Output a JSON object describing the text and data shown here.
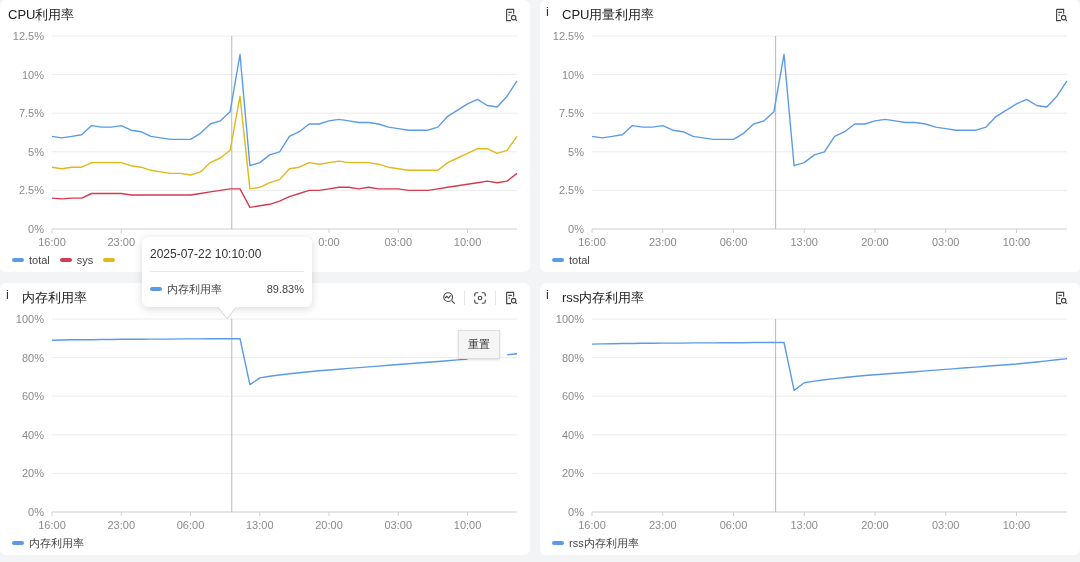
{
  "panels": [
    {
      "title": "CPU利用率",
      "tools": [
        {
          "kind": "detail"
        }
      ],
      "chart_data": {
        "type": "line",
        "ylim": [
          0,
          12.5
        ],
        "yticks": [
          {
            "value": 0,
            "label": "0%"
          },
          {
            "value": 2.5,
            "label": "2.5%"
          },
          {
            "value": 5,
            "label": "5%"
          },
          {
            "value": 7.5,
            "label": "7.5%"
          },
          {
            "value": 10,
            "label": "10%"
          },
          {
            "value": 12.5,
            "label": "12.5%"
          }
        ],
        "categories": [
          "16:00",
          null,
          null,
          null,
          null,
          null,
          null,
          "23:00",
          null,
          null,
          null,
          null,
          null,
          null,
          null,
          null,
          null,
          null,
          null,
          null,
          null,
          null,
          null,
          null,
          null,
          null,
          null,
          null,
          "0:00",
          null,
          null,
          null,
          null,
          null,
          null,
          "03:00",
          null,
          null,
          null,
          null,
          null,
          null,
          "10:00",
          null,
          null,
          null,
          null,
          null
        ],
        "series": [
          {
            "name": "total",
            "color": "#5b9be6",
            "values": [
              6.0,
              5.9,
              6.0,
              6.1,
              6.7,
              6.6,
              6.6,
              6.7,
              6.4,
              6.3,
              6.0,
              5.9,
              5.8,
              5.8,
              5.8,
              6.2,
              6.8,
              7.0,
              7.6,
              11.3,
              4.1,
              4.3,
              4.8,
              5.0,
              6.0,
              6.3,
              6.8,
              6.8,
              7.0,
              7.1,
              7.0,
              6.9,
              6.9,
              6.8,
              6.6,
              6.5,
              6.4,
              6.4,
              6.4,
              6.6,
              7.3,
              7.7,
              8.1,
              8.4,
              8.0,
              7.9,
              8.6,
              9.6
            ]
          },
          {
            "name": "sys",
            "color": "#d63a4f",
            "values": [
              2.0,
              1.95,
              2.0,
              2.0,
              2.3,
              2.3,
              2.3,
              2.3,
              2.2,
              2.2,
              2.2,
              2.2,
              2.2,
              2.2,
              2.2,
              2.3,
              2.4,
              2.5,
              2.6,
              2.6,
              1.4,
              1.5,
              1.6,
              1.8,
              2.1,
              2.3,
              2.5,
              2.5,
              2.6,
              2.7,
              2.7,
              2.6,
              2.7,
              2.6,
              2.6,
              2.6,
              2.5,
              2.5,
              2.5,
              2.6,
              2.7,
              2.8,
              2.9,
              3.0,
              3.1,
              3.0,
              3.1,
              3.6
            ]
          },
          {
            "color": "#e0b81c",
            "values": [
              4.0,
              3.9,
              4.0,
              4.0,
              4.3,
              4.3,
              4.3,
              4.3,
              4.1,
              4.0,
              3.8,
              3.7,
              3.6,
              3.6,
              3.5,
              3.7,
              4.3,
              4.6,
              5.1,
              8.6,
              2.6,
              2.7,
              3.0,
              3.2,
              3.9,
              4.0,
              4.3,
              4.2,
              4.3,
              4.4,
              4.3,
              4.3,
              4.3,
              4.2,
              4.0,
              3.9,
              3.8,
              3.8,
              3.8,
              3.8,
              4.3,
              4.6,
              4.9,
              5.2,
              5.2,
              4.9,
              5.1,
              6.0
            ]
          }
        ],
        "grid": true
      }
    },
    {
      "info_mark": "i",
      "title": "CPU用量利用率",
      "tools": [
        {
          "kind": "detail"
        }
      ],
      "chart_data": {
        "type": "line",
        "ylim": [
          0,
          12.5
        ],
        "yticks": [
          {
            "value": 0,
            "label": "0%"
          },
          {
            "value": 2.5,
            "label": "2.5%"
          },
          {
            "value": 5,
            "label": "5%"
          },
          {
            "value": 7.5,
            "label": "7.5%"
          },
          {
            "value": 10,
            "label": "10%"
          },
          {
            "value": 12.5,
            "label": "12.5%"
          }
        ],
        "categories": [
          "16:00",
          null,
          null,
          null,
          null,
          null,
          null,
          "23:00",
          null,
          null,
          null,
          null,
          null,
          null,
          "06:00",
          null,
          null,
          null,
          null,
          null,
          null,
          "13:00",
          null,
          null,
          null,
          null,
          null,
          null,
          "20:00",
          null,
          null,
          null,
          null,
          null,
          null,
          "03:00",
          null,
          null,
          null,
          null,
          null,
          null,
          "10:00",
          null,
          null,
          null,
          null,
          null
        ],
        "series": [
          {
            "name": "total",
            "color": "#5b9be6",
            "values": [
              6.0,
              5.9,
              6.0,
              6.1,
              6.7,
              6.6,
              6.6,
              6.7,
              6.4,
              6.3,
              6.0,
              5.9,
              5.8,
              5.8,
              5.8,
              6.2,
              6.8,
              7.0,
              7.6,
              11.3,
              4.1,
              4.3,
              4.8,
              5.0,
              6.0,
              6.3,
              6.8,
              6.8,
              7.0,
              7.1,
              7.0,
              6.9,
              6.9,
              6.8,
              6.6,
              6.5,
              6.4,
              6.4,
              6.4,
              6.6,
              7.3,
              7.7,
              8.1,
              8.4,
              8.0,
              7.9,
              8.6,
              9.6
            ]
          }
        ],
        "grid": true
      }
    },
    {
      "info_mark": "i",
      "title": "内存利用率",
      "tools": [
        {
          "kind": "zoom"
        },
        {
          "kind": "focus"
        },
        {
          "kind": "detail"
        }
      ],
      "reset_tooltip": "重置",
      "chart_data": {
        "type": "line",
        "ylim": [
          0,
          100
        ],
        "yticks": [
          {
            "value": 0,
            "label": "0%"
          },
          {
            "value": 20,
            "label": "20%"
          },
          {
            "value": 40,
            "label": "40%"
          },
          {
            "value": 60,
            "label": "60%"
          },
          {
            "value": 80,
            "label": "80%"
          },
          {
            "value": 100,
            "label": "100%"
          }
        ],
        "categories": [
          "16:00",
          null,
          null,
          null,
          null,
          null,
          null,
          "23:00",
          null,
          null,
          null,
          null,
          null,
          null,
          "06:00",
          null,
          null,
          null,
          null,
          null,
          null,
          "13:00",
          null,
          null,
          null,
          null,
          null,
          null,
          "20:00",
          null,
          null,
          null,
          null,
          null,
          null,
          "03:00",
          null,
          null,
          null,
          null,
          null,
          null,
          "10:00",
          null,
          null,
          null,
          null,
          null
        ],
        "series": [
          {
            "name": "内存利用率",
            "color": "#5b9be6",
            "values": [
              89.0,
              89.1,
              89.2,
              89.3,
              89.3,
              89.4,
              89.4,
              89.5,
              89.5,
              89.5,
              89.6,
              89.6,
              89.6,
              89.7,
              89.7,
              89.7,
              89.8,
              89.8,
              89.8,
              89.8,
              66,
              69.5,
              70.3,
              71.0,
              71.6,
              72.2,
              72.7,
              73.2,
              73.6,
              74.0,
              74.4,
              74.8,
              75.2,
              75.6,
              76.0,
              76.4,
              76.8,
              77.2,
              77.6,
              78.0,
              78.4,
              78.8,
              79.2,
              null,
              null,
              null,
              81.4,
              82.0
            ]
          }
        ],
        "grid": true
      }
    },
    {
      "info_mark": "i",
      "title": "rss内存利用率",
      "tools": [
        {
          "kind": "detail"
        }
      ],
      "chart_data": {
        "type": "line",
        "ylim": [
          0,
          100
        ],
        "yticks": [
          {
            "value": 0,
            "label": "0%"
          },
          {
            "value": 20,
            "label": "20%"
          },
          {
            "value": 40,
            "label": "40%"
          },
          {
            "value": 60,
            "label": "60%"
          },
          {
            "value": 80,
            "label": "80%"
          },
          {
            "value": 100,
            "label": "100%"
          }
        ],
        "categories": [
          "16:00",
          null,
          null,
          null,
          null,
          null,
          null,
          "23:00",
          null,
          null,
          null,
          null,
          null,
          null,
          "06:00",
          null,
          null,
          null,
          null,
          null,
          null,
          "13:00",
          null,
          null,
          null,
          null,
          null,
          null,
          "20:00",
          null,
          null,
          null,
          null,
          null,
          null,
          "03:00",
          null,
          null,
          null,
          null,
          null,
          null,
          "10:00",
          null,
          null,
          null,
          null,
          null
        ],
        "series": [
          {
            "name": "rss内存利用率",
            "color": "#5b9be6",
            "values": [
              87.0,
              87.1,
              87.2,
              87.3,
              87.3,
              87.4,
              87.4,
              87.5,
              87.5,
              87.5,
              87.6,
              87.6,
              87.6,
              87.7,
              87.7,
              87.7,
              87.8,
              87.8,
              87.8,
              87.8,
              63,
              67.0,
              67.8,
              68.5,
              69.1,
              69.7,
              70.2,
              70.7,
              71.1,
              71.5,
              71.9,
              72.3,
              72.7,
              73.1,
              73.5,
              73.9,
              74.3,
              74.7,
              75.1,
              75.5,
              75.9,
              76.3,
              76.7,
              77.2,
              77.7,
              78.3,
              78.9,
              79.5
            ]
          }
        ],
        "grid": true
      }
    }
  ],
  "tooltip": {
    "time": "2025-07-22 10:10:00",
    "series": "内存利用率",
    "value": "89.83%",
    "color": "#5b9be6"
  }
}
